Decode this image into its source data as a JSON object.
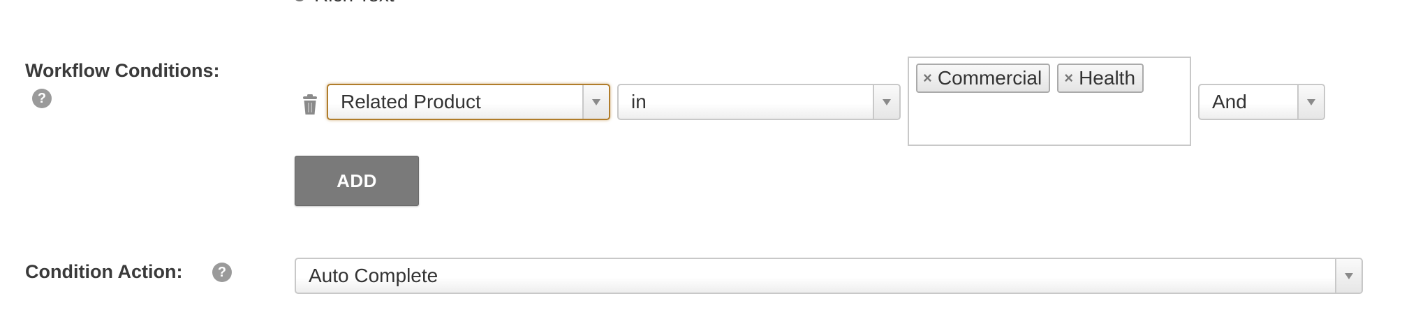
{
  "top_option": {
    "label": "Rich Text"
  },
  "workflow_conditions": {
    "label": "Workflow Conditions:",
    "help_icon": "?",
    "rows": [
      {
        "field": "Related Product",
        "operator": "in",
        "values": [
          "Commercial",
          "Health"
        ],
        "tag_remove_glyph": "×",
        "conjunction": "And"
      }
    ],
    "add_label": "ADD"
  },
  "condition_action": {
    "label": "Condition Action:",
    "help_icon": "?",
    "value": "Auto Complete"
  },
  "colors": {
    "focus_border": "#b07c2a",
    "add_button_bg": "#7a7a7a",
    "help_icon_bg": "#9a9a9a",
    "label_text": "#3a3a3a"
  }
}
